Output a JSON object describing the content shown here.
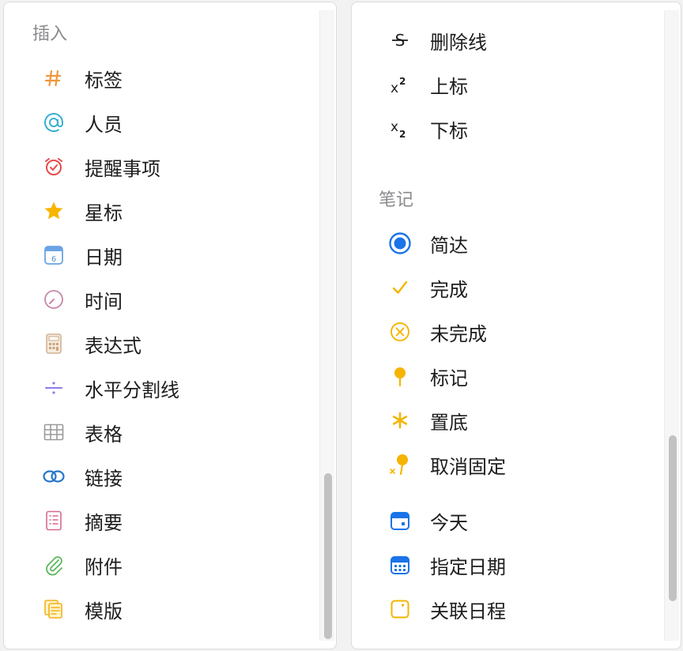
{
  "left": {
    "header": "插入",
    "items": [
      {
        "label": "标签",
        "icon": "hashtag-icon"
      },
      {
        "label": "人员",
        "icon": "at-icon"
      },
      {
        "label": "提醒事项",
        "icon": "alarm-clock-icon"
      },
      {
        "label": "星标",
        "icon": "star-icon"
      },
      {
        "label": "日期",
        "icon": "calendar-icon"
      },
      {
        "label": "时间",
        "icon": "clock-icon"
      },
      {
        "label": "表达式",
        "icon": "calculator-icon"
      },
      {
        "label": "水平分割线",
        "icon": "divider-icon"
      },
      {
        "label": "表格",
        "icon": "table-icon"
      },
      {
        "label": "链接",
        "icon": "link-icon"
      },
      {
        "label": "摘要",
        "icon": "summary-icon"
      },
      {
        "label": "附件",
        "icon": "paperclip-icon"
      },
      {
        "label": "模版",
        "icon": "template-icon"
      }
    ]
  },
  "right": {
    "format_items": [
      {
        "label": "删除线",
        "icon": "strikethrough-icon",
        "glyph": "S"
      },
      {
        "label": "上标",
        "icon": "superscript-icon",
        "glyph": "x",
        "mark": "2"
      },
      {
        "label": "下标",
        "icon": "subscript-icon",
        "glyph": "x",
        "mark": "2"
      }
    ],
    "header": "笔记",
    "note_items": [
      {
        "label": "简达",
        "icon": "radio-selected-icon"
      },
      {
        "label": "完成",
        "icon": "checkmark-icon"
      },
      {
        "label": "未完成",
        "icon": "circle-x-icon"
      },
      {
        "label": "标记",
        "icon": "pin-icon"
      },
      {
        "label": "置底",
        "icon": "asterisk-icon"
      },
      {
        "label": "取消固定",
        "icon": "unpin-icon"
      }
    ],
    "date_items": [
      {
        "label": "今天",
        "icon": "calendar-today-icon"
      },
      {
        "label": "指定日期",
        "icon": "calendar-grid-icon"
      },
      {
        "label": "关联日程",
        "icon": "schedule-link-icon"
      }
    ]
  },
  "colors": {
    "accent_blue": "#1a73e8",
    "accent_yellow": "#f5b400",
    "header_gray": "#8a8a8e",
    "text": "#1d1d1f"
  }
}
